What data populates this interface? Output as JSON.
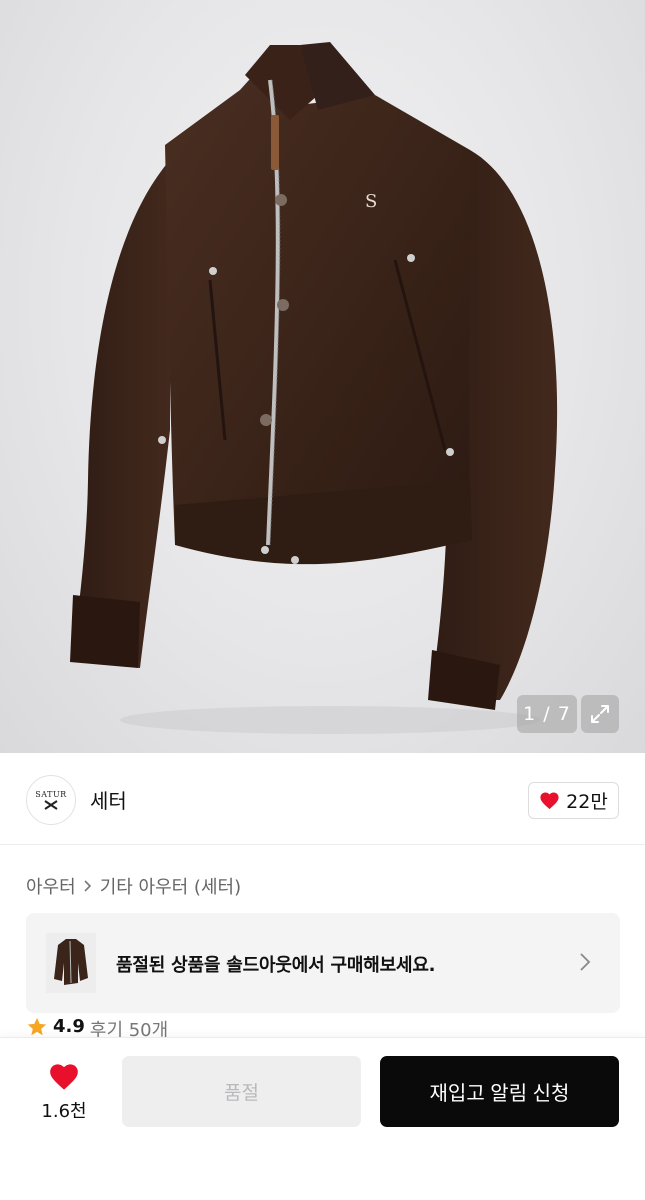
{
  "gallery": {
    "counter": "1 / 7",
    "image_alt": "brown zip-up jacket"
  },
  "brand": {
    "logo_text_top": "SATUR",
    "name": "세터",
    "like_count": "22만"
  },
  "breadcrumb": {
    "category": "아우터",
    "subcategory": "기타 아우터 (세터)"
  },
  "banner": {
    "text": "품절된 상품을 솔드아웃에서 구매해보세요."
  },
  "rating": {
    "score": "4.9",
    "reviews": "후기 50개"
  },
  "bottom": {
    "wish_count": "1.6천",
    "soldout_label": "품절",
    "restock_label": "재입고 알림 신청"
  },
  "colors": {
    "heart": "#e8102a",
    "star": "#f5a623",
    "jacket": "#3b2419",
    "primary_button": "#0a0a0a"
  }
}
